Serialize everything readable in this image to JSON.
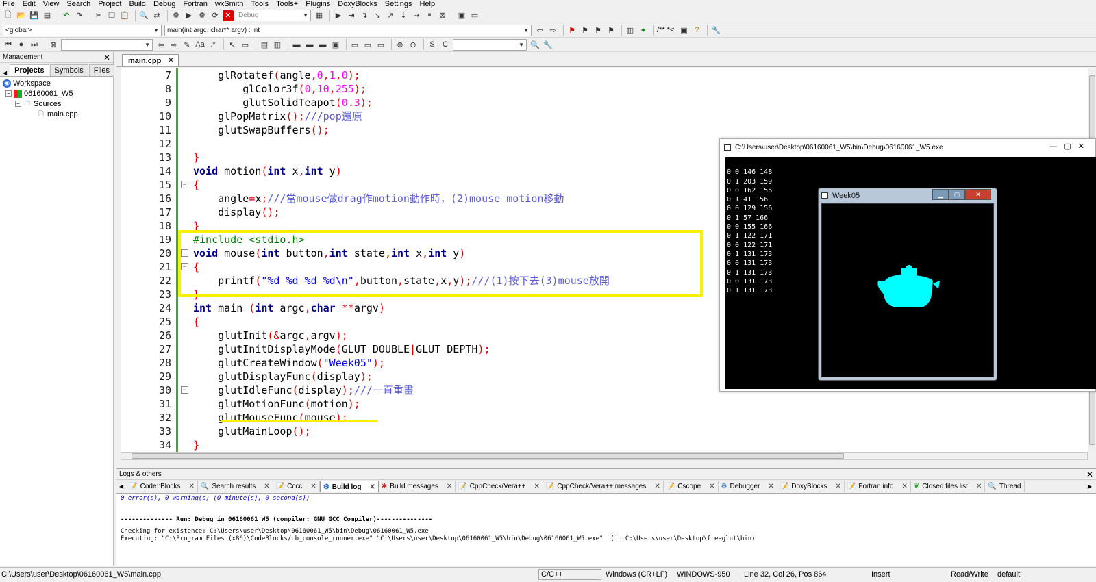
{
  "menu": [
    "File",
    "Edit",
    "View",
    "Search",
    "Project",
    "Build",
    "Debug",
    "Fortran",
    "wxSmith",
    "Tools",
    "Tools+",
    "Plugins",
    "DoxyBlocks",
    "Settings",
    "Help"
  ],
  "toolbar": {
    "build_target": "Debug",
    "scope_combo": "<global>",
    "function_combo": "main(int argc, char** argv) : int",
    "comment_btn": "/** *<"
  },
  "management": {
    "title": "Management",
    "tabs": [
      "Projects",
      "Symbols",
      "Files"
    ],
    "tree": {
      "workspace": "Workspace",
      "project": "06160061_W5",
      "folder": "Sources",
      "file": "main.cpp"
    }
  },
  "editor": {
    "tab_label": "main.cpp",
    "lines": [
      "7",
      "8",
      "9",
      "10",
      "11",
      "12",
      "13",
      "14",
      "15",
      "16",
      "17",
      "18",
      "19",
      "20",
      "21",
      "22",
      "23",
      "24",
      "25",
      "26",
      "27",
      "28",
      "29",
      "30",
      "31",
      "32",
      "33",
      "34"
    ]
  },
  "console": {
    "title": "C:\\Users\\user\\Desktop\\06160061_W5\\bin\\Debug\\06160061_W5.exe",
    "lines": [
      "0 0 146 148",
      "0 1 203 159",
      "0 0 162 156",
      "0 1 41 156",
      "0 0 129 156",
      "0 1 57 166",
      "0 0 155 166",
      "0 1 122 171",
      "0 0 122 171",
      "0 1 131 173",
      "0 0 131 173",
      "0 1 131 173",
      "0 0 131 173",
      "0 1 131 173"
    ]
  },
  "glwindow": {
    "title": "Week05",
    "teapot_color": "#00ffff"
  },
  "logs": {
    "title": "Logs & others",
    "tabs": [
      "Code::Blocks",
      "Search results",
      "Cccc",
      "Build log",
      "Build messages",
      "CppCheck/Vera++",
      "CppCheck/Vera++ messages",
      "Cscope",
      "Debugger",
      "DoxyBlocks",
      "Fortran info",
      "Closed files list",
      "Thread"
    ],
    "active_tab": "Build log",
    "line1": "0 error(s), 0 warning(s) (0 minute(s), 0 second(s))",
    "line2": "-------------- Run: Debug in 06160061_W5 (compiler: GNU GCC Compiler)---------------",
    "line3": "Checking for existence: C:\\Users\\user\\Desktop\\06160061_W5\\bin\\Debug\\06160061_W5.exe",
    "line4": "Executing: \"C:\\Program Files (x86)\\CodeBlocks/cb_console_runner.exe\" \"C:\\Users\\user\\Desktop\\06160061_W5\\bin\\Debug\\06160061_W5.exe\"  (in C:\\Users\\user\\Desktop\\freeglut\\bin)"
  },
  "status": {
    "path": "C:\\Users\\user\\Desktop\\06160061_W5\\main.cpp",
    "lang": "C/C++",
    "eol": "Windows (CR+LF)",
    "encoding": "WINDOWS-950",
    "position": "Line 32, Col 26, Pos 864",
    "mode": "Insert",
    "rw": "Read/Write",
    "profile": "default"
  },
  "colors": {
    "highlight": "#ffee00",
    "changebar": "#18c018",
    "keyword": "#00008b",
    "number": "#ff00ff"
  }
}
